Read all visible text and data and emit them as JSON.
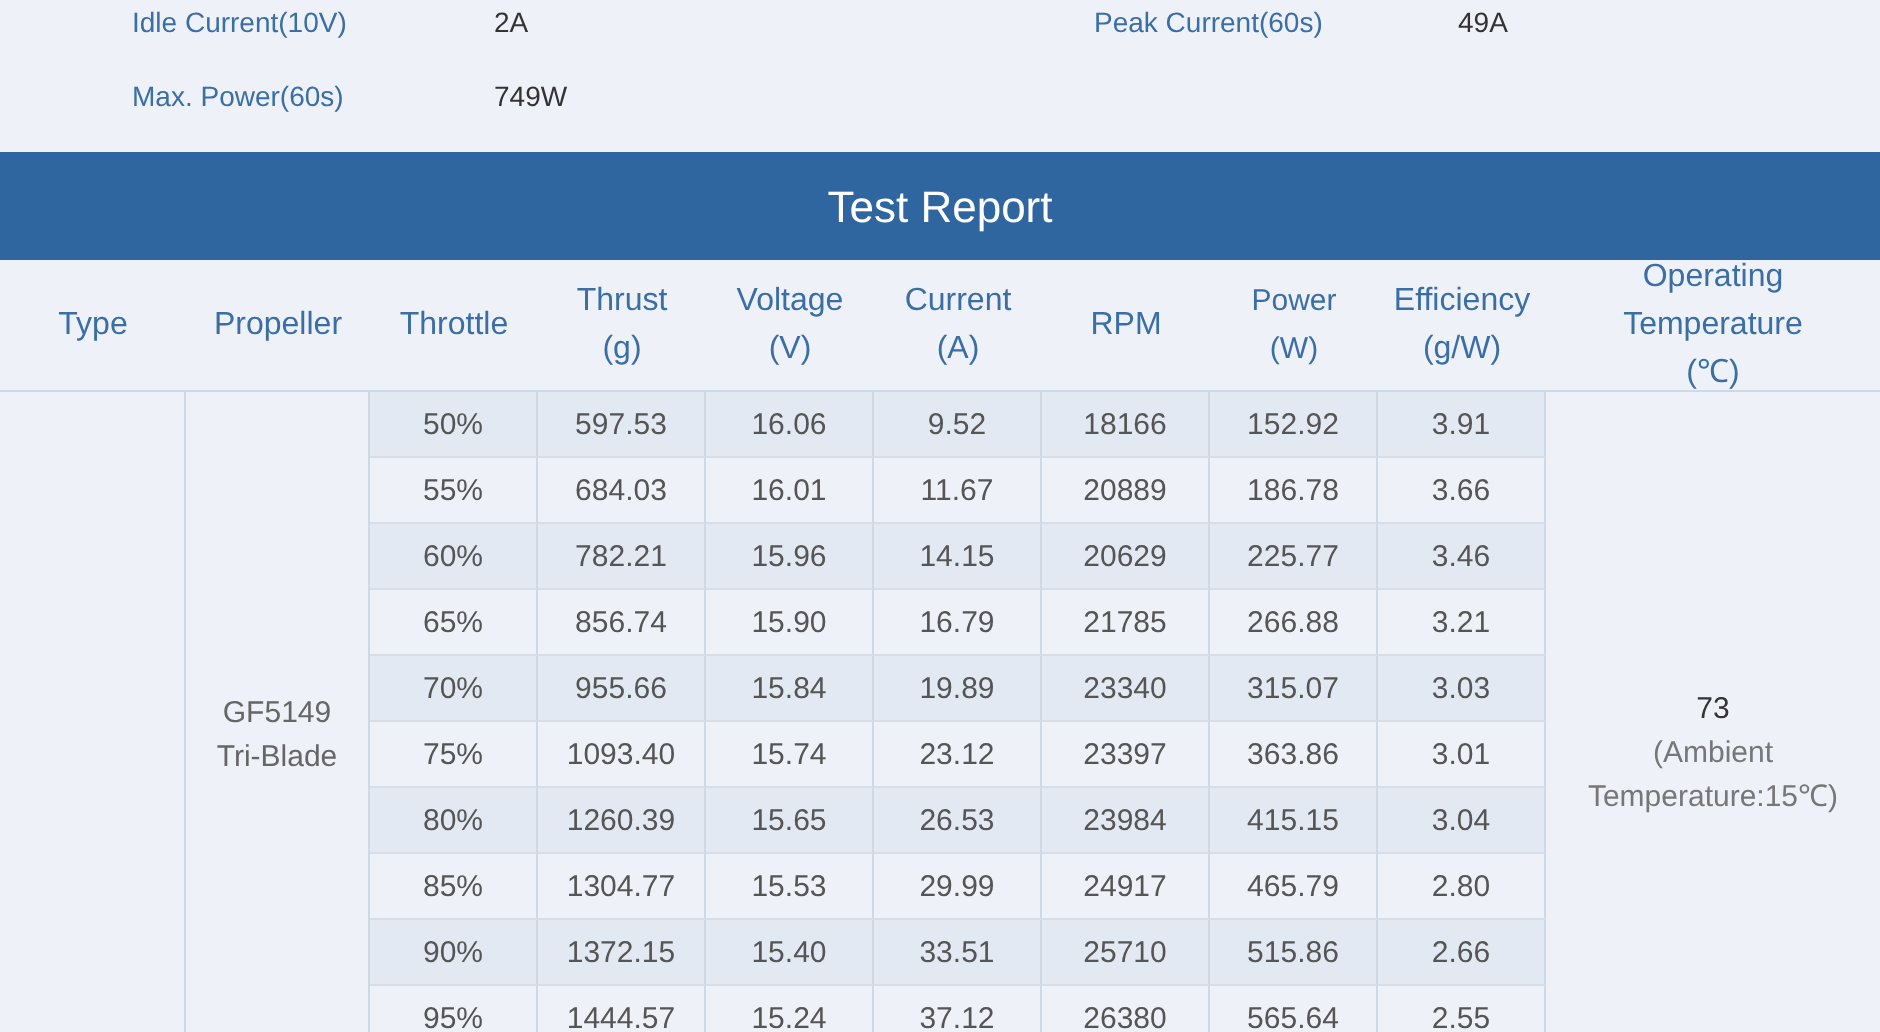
{
  "specs": [
    {
      "label": "Idle Current(10V)",
      "value": "2A"
    },
    {
      "label": "Peak Current(60s)",
      "value": "49A"
    },
    {
      "label": "Max. Power(60s)",
      "value": "749W"
    }
  ],
  "report": {
    "title": "Test Report",
    "columns": [
      {
        "label": "Type"
      },
      {
        "label": "Propeller"
      },
      {
        "label": "Throttle"
      },
      {
        "label": "Thrust\n(g)"
      },
      {
        "label": "Voltage\n(V)"
      },
      {
        "label": "Current\n(A)"
      },
      {
        "label": "RPM"
      },
      {
        "label": "Power\n(W)"
      },
      {
        "label": "Efficiency\n(g/W)"
      },
      {
        "label": "Operating\nTemperature\n(℃)"
      }
    ],
    "propeller": "GF5149\nTri-Blade",
    "temperature": {
      "value": "73",
      "note": "(Ambient\nTemperature:15℃)"
    },
    "rows": [
      {
        "throttle": "50%",
        "thrust": "597.53",
        "voltage": "16.06",
        "current": "9.52",
        "rpm": "18166",
        "power": "152.92",
        "efficiency": "3.91"
      },
      {
        "throttle": "55%",
        "thrust": "684.03",
        "voltage": "16.01",
        "current": "11.67",
        "rpm": "20889",
        "power": "186.78",
        "efficiency": "3.66"
      },
      {
        "throttle": "60%",
        "thrust": "782.21",
        "voltage": "15.96",
        "current": "14.15",
        "rpm": "20629",
        "power": "225.77",
        "efficiency": "3.46"
      },
      {
        "throttle": "65%",
        "thrust": "856.74",
        "voltage": "15.90",
        "current": "16.79",
        "rpm": "21785",
        "power": "266.88",
        "efficiency": "3.21"
      },
      {
        "throttle": "70%",
        "thrust": "955.66",
        "voltage": "15.84",
        "current": "19.89",
        "rpm": "23340",
        "power": "315.07",
        "efficiency": "3.03"
      },
      {
        "throttle": "75%",
        "thrust": "1093.40",
        "voltage": "15.74",
        "current": "23.12",
        "rpm": "23397",
        "power": "363.86",
        "efficiency": "3.01"
      },
      {
        "throttle": "80%",
        "thrust": "1260.39",
        "voltage": "15.65",
        "current": "26.53",
        "rpm": "23984",
        "power": "415.15",
        "efficiency": "3.04"
      },
      {
        "throttle": "85%",
        "thrust": "1304.77",
        "voltage": "15.53",
        "current": "29.99",
        "rpm": "24917",
        "power": "465.79",
        "efficiency": "2.80"
      },
      {
        "throttle": "90%",
        "thrust": "1372.15",
        "voltage": "15.40",
        "current": "33.51",
        "rpm": "25710",
        "power": "515.86",
        "efficiency": "2.66"
      },
      {
        "throttle": "95%",
        "thrust": "1444.57",
        "voltage": "15.24",
        "current": "37.12",
        "rpm": "26380",
        "power": "565.64",
        "efficiency": "2.55"
      }
    ]
  }
}
